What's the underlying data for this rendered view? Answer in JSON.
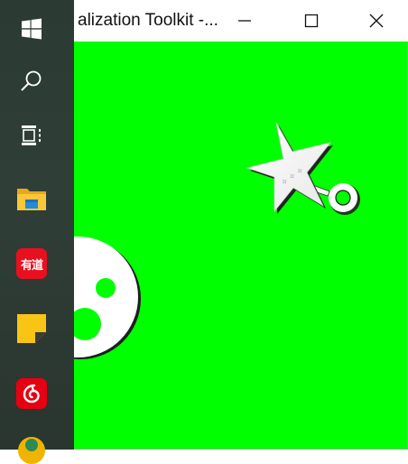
{
  "window": {
    "title": "alization Toolkit -..."
  },
  "taskbar": {
    "items": [
      {
        "name": "windows-start-icon",
        "color": "#ffffff"
      },
      {
        "name": "search-icon",
        "color": "#ffffff"
      },
      {
        "name": "task-view-icon",
        "color": "#ffffff"
      },
      {
        "name": "file-explorer-icon",
        "color": "#f4b400"
      },
      {
        "name": "youdao-icon",
        "label": "有道",
        "color": "#e8101f"
      },
      {
        "name": "sticky-notes-icon",
        "color": "#f8c517"
      },
      {
        "name": "netease-music-icon",
        "color": "#e60012"
      },
      {
        "name": "partial-app-icon",
        "color": "#f0b400"
      }
    ]
  },
  "scene": {
    "background": "#00ff00",
    "star_glyphs": "✧ ✧ ✧"
  }
}
